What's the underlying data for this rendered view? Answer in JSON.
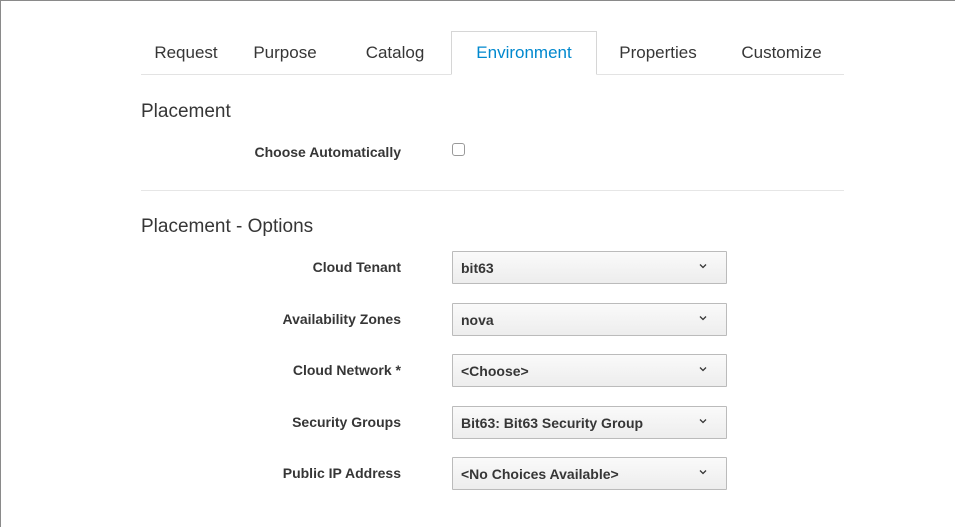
{
  "tabs": [
    {
      "label": "Request",
      "active": false
    },
    {
      "label": "Purpose",
      "active": false
    },
    {
      "label": "Catalog",
      "active": false
    },
    {
      "label": "Environment",
      "active": true
    },
    {
      "label": "Properties",
      "active": false
    },
    {
      "label": "Customize",
      "active": false
    }
  ],
  "placement": {
    "title": "Placement",
    "choose_auto_label": "Choose Automatically",
    "choose_auto_checked": false
  },
  "options": {
    "title": "Placement - Options",
    "fields": [
      {
        "label": "Cloud Tenant",
        "value": "bit63"
      },
      {
        "label": "Availability Zones",
        "value": "nova"
      },
      {
        "label": "Cloud Network *",
        "value": "<Choose>"
      },
      {
        "label": "Security Groups",
        "value": "Bit63: Bit63 Security Group"
      },
      {
        "label": "Public IP Address",
        "value": "<No Choices Available>"
      }
    ]
  },
  "colors": {
    "active_tab": "#0088ce",
    "text": "#363636",
    "border": "#bbbbbb"
  }
}
